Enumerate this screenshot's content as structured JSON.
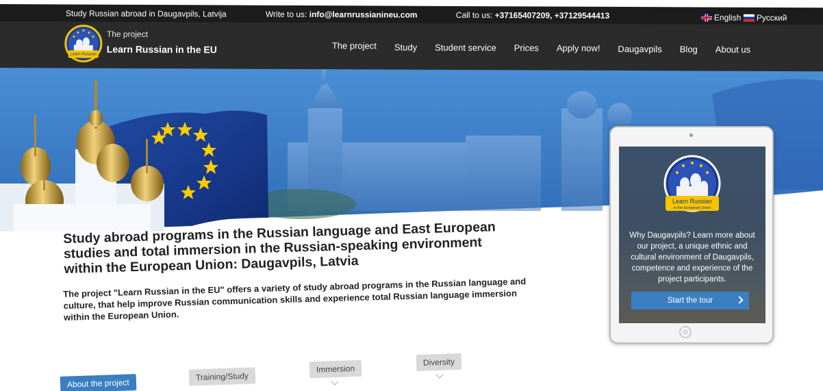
{
  "topbar": {
    "location": "Study Russian abroad in Daugavpils, Latvija",
    "write_label": "Write to us:",
    "email": "info@learnrussianineu.com",
    "call_label": "Call to us:",
    "phones": "+37165407209, +37129544413",
    "lang_en": "English",
    "lang_ru": "Русский"
  },
  "brand": {
    "subtitle": "The project",
    "title": "Learn Russian in the EU",
    "logo_line1": "Learn Russian",
    "logo_line2": "in the European Union"
  },
  "nav": {
    "items": [
      "The project",
      "Study",
      "Student service",
      "Prices",
      "Apply now!",
      "Daugavpils",
      "Blog",
      "About us"
    ]
  },
  "main": {
    "headline": "Study abroad programs in the Russian language and East European studies and total immersion in the Russian-speaking environment within the European Union: Daugavpils, Latvia",
    "lead": "The project \"Learn Russian in the EU\" offers a variety of study abroad programs in the Russian language and culture, that help improve Russian communication skills and experience total Russian language immersion within the European Union."
  },
  "tabs": [
    "About the project",
    "Training/Study",
    "Immersion",
    "Diversity"
  ],
  "tablet": {
    "text": "Why Daugavpils? Learn more about our project, a unique ethnic and cultural environment of Daugavpils, competence and experience of the project participants.",
    "button": "Start the tour"
  },
  "colors": {
    "accent": "#3a7fc1",
    "topbar": "#1c1c1c",
    "navbar": "#2b2b2b",
    "eu_blue": "#1a3f91",
    "star_yellow": "#ffcc00"
  }
}
